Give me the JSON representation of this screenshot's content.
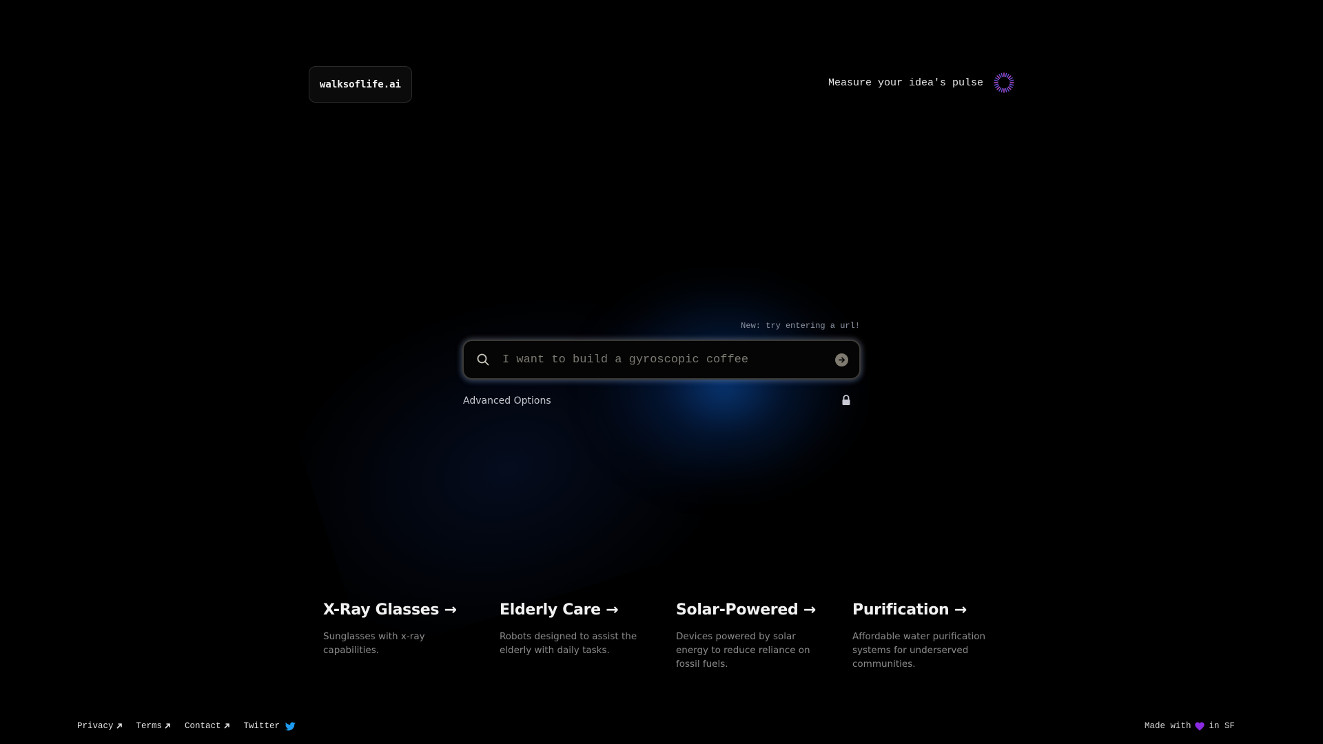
{
  "header": {
    "logo": "walksoflife.ai",
    "pulse_text": "Measure your idea's pulse",
    "pulse_icon": "spinner-ring-icon",
    "pulse_color": "#6b4fd8"
  },
  "search": {
    "hint": "New: try entering a url!",
    "placeholder": "I want to build a gyroscopic coffee",
    "value": "",
    "search_icon": "search-icon",
    "submit_icon": "arrow-right-circle-icon"
  },
  "advanced": {
    "label": "Advanced Options",
    "lock_icon": "lock-icon"
  },
  "ideas": [
    {
      "title": "X-Ray Glasses →",
      "description": "Sunglasses with x-ray capabilities."
    },
    {
      "title": "Elderly Care →",
      "description": "Robots designed to assist the elderly with daily tasks."
    },
    {
      "title": "Solar-Powered →",
      "description": "Devices powered by solar energy to reduce reliance on fossil fuels."
    },
    {
      "title": "Purification →",
      "description": "Affordable water purification systems for underserved communities."
    }
  ],
  "footer": {
    "links": [
      {
        "label": "Privacy",
        "icon": "external-link-icon"
      },
      {
        "label": "Terms",
        "icon": "external-link-icon"
      },
      {
        "label": "Contact",
        "icon": "external-link-icon"
      },
      {
        "label": "Twitter",
        "icon": "twitter-bird-icon"
      }
    ],
    "made_with": "Made with",
    "heart_icon": "purple-heart-icon",
    "location": "in SF",
    "twitter_color": "#1d9bf0",
    "heart_color": "#8a2be2"
  }
}
